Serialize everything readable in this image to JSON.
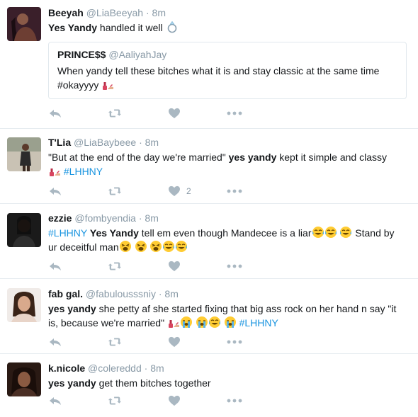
{
  "tweets": [
    {
      "name": "Beeyah",
      "handle": "@LiaBeeyah",
      "time": "8m",
      "text_bold": "Yes Yandy",
      "text_rest": " handled it well",
      "quote": {
        "name": "PRINCE$$",
        "handle": "@AaliyahJay",
        "line1": "When yandy tell these bitches what it is and stay classic at the same time",
        "line2": "#okayyyy"
      }
    },
    {
      "name": "T'Lia",
      "handle": "@LiaBaybeee",
      "time": "8m",
      "text_pre": "\"But at the end of the day we're married\" ",
      "text_bold": "yes yandy",
      "text_post": " kept it simple and classy",
      "hashtag": "#LHHNY",
      "like_count": "2"
    },
    {
      "name": "ezzie",
      "handle": "@fombyendia",
      "time": "8m",
      "hashtag": "#LHHNY",
      "text_bold": "Yes Yandy",
      "text_mid": " tell em even though Mandecee is a liar",
      "text_mid2": " Stand by",
      "text_line2": "ur deceitful man"
    },
    {
      "name": "fab gal.",
      "handle": "@fabulousssniy",
      "time": "8m",
      "text_bold": "yes yandy",
      "text_rest": " she petty af she started fixing that big ass rock on her hand n say \"it",
      "text_line2": "is, because we're married\"",
      "hashtag": "#LHHNY"
    },
    {
      "name": "k.nicole",
      "handle": "@colereddd",
      "time": "8m",
      "text_bold": "yes yandy",
      "text_rest": " get them bitches together"
    }
  ],
  "separator": "·",
  "icons": [
    "reply-icon",
    "retweet-icon",
    "like-icon",
    "more-icon",
    "ring-emoji",
    "nail-polish-emoji",
    "tears-of-joy-emoji",
    "weary-emoji",
    "crying-emoji"
  ],
  "colors": {
    "text": "#14171a",
    "muted": "#8899a6",
    "hashtag": "#1b95e0",
    "action": "#aab8c2",
    "border": "#e6ecf0"
  }
}
